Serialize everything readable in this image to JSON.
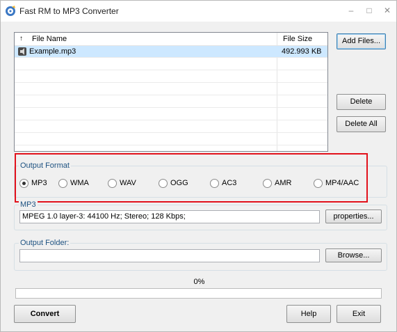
{
  "window": {
    "title": "Fast RM to MP3 Converter",
    "minimize_glyph": "–",
    "maximize_glyph": "□",
    "close_glyph": "✕"
  },
  "file_list": {
    "sort_arrow": "↑",
    "columns": [
      "File Name",
      "File Size"
    ],
    "rows": [
      {
        "name": "Example.mp3",
        "size": "492.993 KB",
        "icon": "audio-file-icon",
        "selected": true
      }
    ]
  },
  "buttons": {
    "add_files": "Add Files...",
    "delete": "Delete",
    "delete_all": "Delete All",
    "properties": "properties...",
    "browse": "Browse...",
    "convert": "Convert",
    "help": "Help",
    "exit": "Exit"
  },
  "output_format": {
    "label": "Output Format",
    "options": [
      "MP3",
      "WMA",
      "WAV",
      "OGG",
      "AC3",
      "AMR",
      "MP4/AAC"
    ],
    "selected": "MP3"
  },
  "mp3_settings": {
    "label": "MP3",
    "value": "MPEG 1.0 layer-3: 44100 Hz; Stereo;  128 Kbps;"
  },
  "output_folder": {
    "label": "Output Folder:",
    "value": ""
  },
  "progress": {
    "text": "0%",
    "value": 0
  },
  "colors": {
    "highlight_box": "#e2111b",
    "group_label": "#1c5180",
    "selected_row": "#cde8ff"
  }
}
